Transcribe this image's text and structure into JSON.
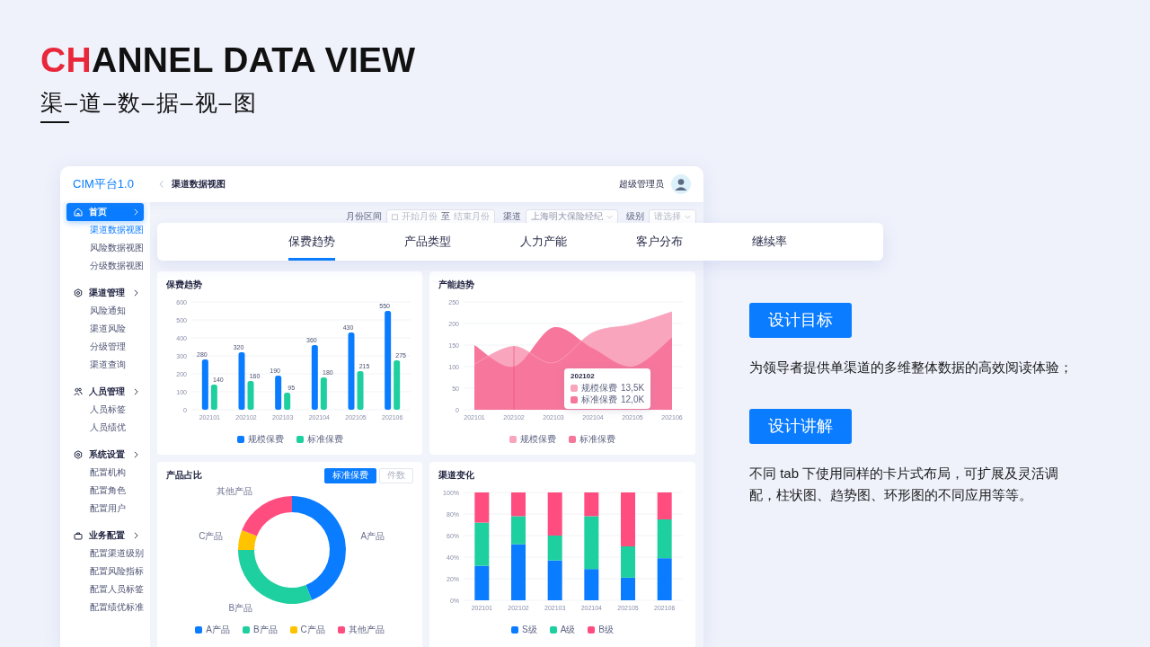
{
  "slide": {
    "title_accent": "CH",
    "title_rest": "ANNEL DATA VIEW",
    "subtitle": "渠–道–数–据–视–图"
  },
  "app": {
    "logo": "CIM平台1.0",
    "breadcrumb": "渠道数据视图",
    "user": "超级管理员",
    "sidebar": [
      {
        "label": "首页",
        "selected": true,
        "children": [
          {
            "label": "渠道数据视图",
            "selected": true
          },
          {
            "label": "风险数据视图",
            "selected": false
          },
          {
            "label": "分级数据视图",
            "selected": false
          }
        ]
      },
      {
        "label": "渠道管理",
        "selected": false,
        "children": [
          {
            "label": "风险通知",
            "selected": false
          },
          {
            "label": "渠道风险",
            "selected": false
          },
          {
            "label": "分级管理",
            "selected": false
          },
          {
            "label": "渠道查询",
            "selected": false
          }
        ]
      },
      {
        "label": "人员管理",
        "selected": false,
        "children": [
          {
            "label": "人员标签",
            "selected": false
          },
          {
            "label": "人员绩优",
            "selected": false
          }
        ]
      },
      {
        "label": "系统设置",
        "selected": false,
        "children": [
          {
            "label": "配置机构",
            "selected": false
          },
          {
            "label": "配置角色",
            "selected": false
          },
          {
            "label": "配置用户",
            "selected": false
          }
        ]
      },
      {
        "label": "业务配置",
        "selected": false,
        "children": [
          {
            "label": "配置渠道级别",
            "selected": false
          },
          {
            "label": "配置风险指标",
            "selected": false
          },
          {
            "label": "配置人员标签",
            "selected": false
          },
          {
            "label": "配置绩优标准",
            "selected": false
          }
        ]
      }
    ],
    "filters": [
      {
        "label": "月份区间",
        "kind": "range",
        "start_placeholder": "开始月份",
        "separator": "至",
        "end_placeholder": "结束月份"
      },
      {
        "label": "渠道",
        "kind": "select",
        "value": "上海明大保险经纪"
      },
      {
        "label": "级别",
        "kind": "select",
        "placeholder": "请选择"
      }
    ],
    "tabs": [
      {
        "label": "保费趋势",
        "selected": true
      },
      {
        "label": "产品类型",
        "selected": false
      },
      {
        "label": "人力产能",
        "selected": false
      },
      {
        "label": "客户分布",
        "selected": false
      },
      {
        "label": "继续率",
        "selected": false
      }
    ],
    "card_rows": [
      {
        "cards": [
          {
            "chart_data": {
              "type": "bar",
              "title": "保费趋势",
              "categories": [
                "202101",
                "202102",
                "202103",
                "202104",
                "202105",
                "202106"
              ],
              "series": [
                {
                  "name": "规模保费",
                  "color": "#0a7cff",
                  "values": [
                    280,
                    320,
                    190,
                    360,
                    430,
                    550
                  ]
                },
                {
                  "name": "标准保费",
                  "color": "#1ecf9f",
                  "values": [
                    140,
                    160,
                    95,
                    180,
                    215,
                    275
                  ]
                }
              ],
              "ylim": [
                0,
                600
              ],
              "yticks": [
                0,
                100,
                200,
                300,
                400,
                500,
                600
              ],
              "grid": true,
              "legend": "bottom",
              "data_labels": true
            }
          },
          {
            "tooltip": {
              "title": "202102",
              "rows": [
                {
                  "label": "规模保费",
                  "value": "13,5K"
                },
                {
                  "label": "标准保费",
                  "value": "12,0K"
                }
              ]
            },
            "chart_data": {
              "type": "area",
              "title": "产能趋势",
              "categories": [
                "202101",
                "202102",
                "202103",
                "202104",
                "202105",
                "202106"
              ],
              "series": [
                {
                  "name": "规模保费",
                  "color": "#f8a5bd",
                  "values": [
                    106,
                    147,
                    109,
                    179,
                    198,
                    227
                  ]
                },
                {
                  "name": "标准保费",
                  "color": "#f7769c",
                  "values": [
                    150,
                    100,
                    191,
                    142,
                    100,
                    167
                  ]
                }
              ],
              "ylim": [
                0,
                250
              ],
              "yticks": [
                0,
                50,
                100,
                150,
                200,
                250
              ],
              "grid": true,
              "legend": "bottom",
              "ref_lines": [
                {
                  "axis": "x",
                  "value": "202102"
                }
              ]
            }
          }
        ]
      },
      {
        "cards": [
          {
            "toggles": [
              {
                "label": "标准保费",
                "selected": true
              },
              {
                "label": "件数",
                "selected": false
              }
            ],
            "chart_data": {
              "type": "donut",
              "title": "产品占比",
              "categories": [
                "A产品",
                "B产品",
                "C产品",
                "其他产品"
              ],
              "series": [
                {
                  "values": [
                    44,
                    31,
                    6,
                    19
                  ]
                }
              ],
              "legend": "bottom"
            }
          },
          {
            "chart_data": {
              "type": "bar",
              "stacked": true,
              "title": "渠道变化",
              "categories": [
                "202101",
                "202102",
                "202103",
                "202104",
                "202105",
                "202106"
              ],
              "series": [
                {
                  "name": "S级",
                  "color": "#0a7cff",
                  "values": [
                    32,
                    52,
                    37,
                    29,
                    21,
                    39
                  ]
                },
                {
                  "name": "A级",
                  "color": "#1ecf9f",
                  "values": [
                    40,
                    26,
                    23,
                    49,
                    29,
                    36
                  ]
                },
                {
                  "name": "B级",
                  "color": "#ff4d80",
                  "values": [
                    28,
                    22,
                    40,
                    22,
                    50,
                    25
                  ]
                }
              ],
              "ylim": [
                0,
                100
              ],
              "yticks": [
                {
                  "value": 0,
                  "label": "0%"
                },
                {
                  "value": 20,
                  "label": "20%"
                },
                {
                  "value": 40,
                  "label": "40%"
                },
                {
                  "value": 60,
                  "label": "60%"
                },
                {
                  "value": 80,
                  "label": "80%"
                },
                {
                  "value": 100,
                  "label": "100%"
                }
              ],
              "grid": true,
              "legend": "bottom"
            }
          }
        ]
      }
    ]
  },
  "notes": [
    {
      "heading": "设计目标",
      "text": "为领导者提供单渠道的多维整体数据的高效阅读体验；"
    },
    {
      "heading": "设计讲解",
      "text": "不同 tab 下使用同样的卡片式布局，可扩展及灵活调配，柱状图、趋势图、环形图的不同应用等等。"
    }
  ]
}
